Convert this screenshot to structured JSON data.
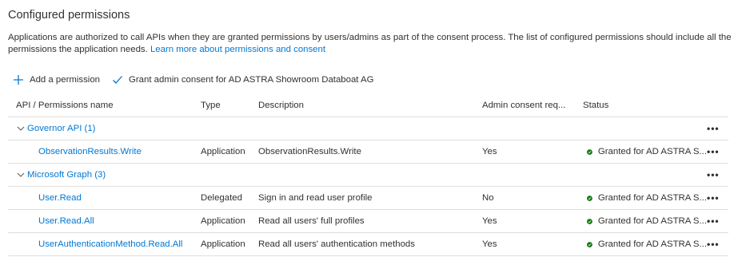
{
  "heading": "Configured permissions",
  "description": "Applications are authorized to call APIs when they are granted permissions by users/admins as part of the consent process. The list of configured permissions should include all the permissions the application needs.",
  "learn_more": "Learn more about permissions and consent",
  "toolbar": {
    "add_label": "Add a permission",
    "grant_label": "Grant admin consent for AD ASTRA Showroom Databoat AG"
  },
  "columns": {
    "name": "API / Permissions name",
    "type": "Type",
    "description": "Description",
    "admin": "Admin consent req...",
    "status": "Status"
  },
  "groups": [
    {
      "label": "Governor API (1)",
      "items": [
        {
          "name": "ObservationResults.Write",
          "type": "Application",
          "description": "ObservationResults.Write",
          "admin": "Yes",
          "status": "Granted for AD ASTRA S..."
        }
      ]
    },
    {
      "label": "Microsoft Graph (3)",
      "items": [
        {
          "name": "User.Read",
          "type": "Delegated",
          "description": "Sign in and read user profile",
          "admin": "No",
          "status": "Granted for AD ASTRA S..."
        },
        {
          "name": "User.Read.All",
          "type": "Application",
          "description": "Read all users' full profiles",
          "admin": "Yes",
          "status": "Granted for AD ASTRA S..."
        },
        {
          "name": "UserAuthenticationMethod.Read.All",
          "type": "Application",
          "description": "Read all users' authentication methods",
          "admin": "Yes",
          "status": "Granted for AD ASTRA S..."
        }
      ]
    }
  ],
  "more_label": "•••",
  "colors": {
    "link": "#0078d4",
    "granted": "#107c10",
    "border": "#e1dfdd"
  }
}
